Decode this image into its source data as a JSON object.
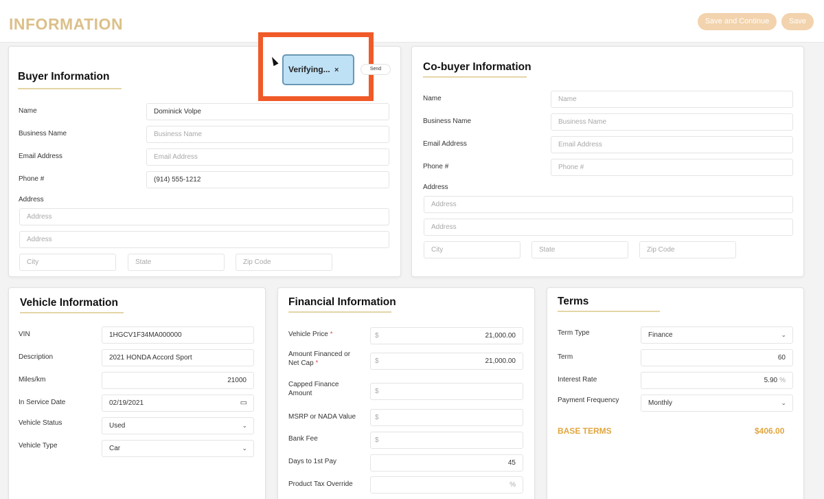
{
  "header": {
    "title": "INFORMATION",
    "save_continue_label": "Save and Continue",
    "save_label": "Save"
  },
  "overlay": {
    "chip_label": "Verifying...",
    "chip_close": "×",
    "send_label": "Send"
  },
  "buyer": {
    "title": "Buyer Information",
    "name_label": "Name",
    "name_value": "Dominick Volpe",
    "business_label": "Business Name",
    "business_placeholder": "Business Name",
    "email_label": "Email Address",
    "email_placeholder": "Email Address",
    "phone_label": "Phone #",
    "phone_value": "(914) 555-1212",
    "address_label": "Address",
    "address1_placeholder": "Address",
    "address2_placeholder": "Address",
    "city_placeholder": "City",
    "state_placeholder": "State",
    "zip_placeholder": "Zip Code"
  },
  "cobuyer": {
    "title": "Co-buyer Information",
    "name_label": "Name",
    "name_placeholder": "Name",
    "business_label": "Business Name",
    "business_placeholder": "Business Name",
    "email_label": "Email Address",
    "email_placeholder": "Email Address",
    "phone_label": "Phone #",
    "phone_placeholder": "Phone #",
    "address_label": "Address",
    "address1_placeholder": "Address",
    "address2_placeholder": "Address",
    "city_placeholder": "City",
    "state_placeholder": "State",
    "zip_placeholder": "Zip Code"
  },
  "vehicle": {
    "title": "Vehicle Information",
    "vin_label": "VIN",
    "vin_value": "1HGCV1F34MA000000",
    "description_label": "Description",
    "description_value": "2021 HONDA Accord Sport",
    "miles_label": "Miles/km",
    "miles_value": "21000",
    "service_date_label": "In Service Date",
    "service_date_value": "02/19/2021",
    "status_label": "Vehicle Status",
    "status_value": "Used",
    "type_label": "Vehicle Type",
    "type_value": "Car"
  },
  "financial": {
    "title": "Financial Information",
    "currency": "$",
    "vehicle_price_label": "Vehicle Price",
    "vehicle_price_value": "21,000.00",
    "amount_financed_label_1": "Amount Financed or",
    "amount_financed_label_2": "Net Cap",
    "amount_financed_value": "21,000.00",
    "capped_label_1": "Capped Finance",
    "capped_label_2": "Amount",
    "msrp_label": "MSRP or NADA Value",
    "bank_fee_label": "Bank Fee",
    "days_label": "Days to 1st Pay",
    "days_value": "45",
    "tax_override_label": "Product Tax Override",
    "percent": "%",
    "required_mark": "*"
  },
  "terms": {
    "title": "Terms",
    "term_type_label": "Term Type",
    "term_type_value": "Finance",
    "term_label": "Term",
    "term_value": "60",
    "interest_label": "Interest Rate",
    "interest_value": "5.90",
    "percent": "%",
    "frequency_label": "Payment Frequency",
    "frequency_value": "Monthly",
    "base_terms_label": "BASE TERMS",
    "base_terms_value": "$406.00"
  },
  "colors": {
    "title_gold": "#dcc08a",
    "button_peach": "#f2d3ad",
    "base_terms_orange": "#e0a53e",
    "highlight_frame": "#f05a28",
    "chip_blue": "#bfe1f6"
  }
}
